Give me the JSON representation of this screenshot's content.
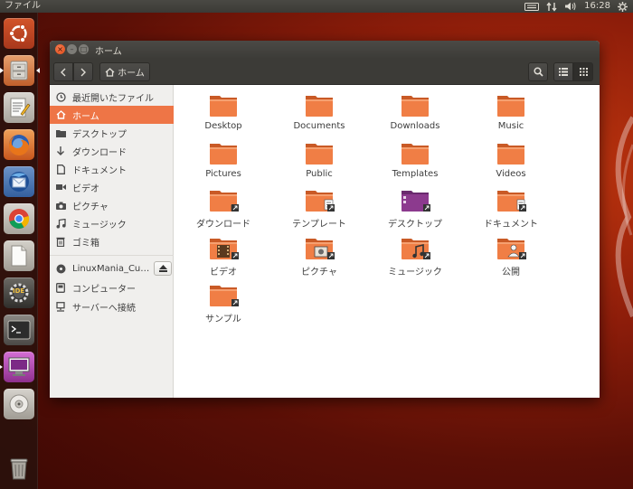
{
  "top_panel": {
    "app_menu": "ファイル",
    "clock": "16:28"
  },
  "launcher": {
    "items": [
      {
        "name": "ubuntu-dash",
        "icon": "ubuntu-logo-icon"
      },
      {
        "name": "files",
        "icon": "file-cabinet-icon",
        "active": true
      },
      {
        "name": "text-editor",
        "icon": "text-editor-icon"
      },
      {
        "name": "firefox",
        "icon": "firefox-icon"
      },
      {
        "name": "thunderbird",
        "icon": "thunderbird-icon"
      },
      {
        "name": "chrome",
        "icon": "chrome-icon"
      },
      {
        "name": "libreoffice",
        "icon": "document-icon"
      },
      {
        "name": "lazarus-ide",
        "icon": "gear-ide-icon"
      },
      {
        "name": "terminal",
        "icon": "terminal-icon"
      },
      {
        "name": "display-settings",
        "icon": "monitor-icon"
      },
      {
        "name": "dvd",
        "icon": "disc-icon"
      },
      {
        "name": "trash",
        "icon": "trash-icon"
      }
    ],
    "ide_label": "IDE"
  },
  "window": {
    "title": "ホーム",
    "path_label": "ホーム"
  },
  "sidebar": {
    "items": [
      {
        "label": "最近開いたファイル",
        "icon": "clock-icon"
      },
      {
        "label": "ホーム",
        "icon": "home-icon",
        "selected": true
      },
      {
        "label": "デスクトップ",
        "icon": "folder-icon"
      },
      {
        "label": "ダウンロード",
        "icon": "download-arrow-icon"
      },
      {
        "label": "ドキュメント",
        "icon": "document-icon"
      },
      {
        "label": "ビデオ",
        "icon": "video-icon"
      },
      {
        "label": "ピクチャ",
        "icon": "camera-icon"
      },
      {
        "label": "ミュージック",
        "icon": "music-note-icon"
      },
      {
        "label": "ゴミ箱",
        "icon": "trash-icon"
      }
    ],
    "devices": [
      {
        "label": "LinuxMania_Cu…",
        "icon": "disc-icon",
        "eject": true
      },
      {
        "label": "コンピューター",
        "icon": "computer-icon"
      },
      {
        "label": "サーバーへ接続",
        "icon": "network-icon"
      }
    ]
  },
  "files": [
    {
      "label": "Desktop",
      "emblem": ""
    },
    {
      "label": "Documents",
      "emblem": ""
    },
    {
      "label": "Downloads",
      "emblem": ""
    },
    {
      "label": "Music",
      "emblem": ""
    },
    {
      "label": "Pictures",
      "emblem": ""
    },
    {
      "label": "Public",
      "emblem": ""
    },
    {
      "label": "Templates",
      "emblem": ""
    },
    {
      "label": "Videos",
      "emblem": ""
    },
    {
      "label": "ダウンロード",
      "emblem": "download"
    },
    {
      "label": "テンプレート",
      "emblem": "template"
    },
    {
      "label": "デスクトップ",
      "emblem": "desktop"
    },
    {
      "label": "ドキュメント",
      "emblem": "document"
    },
    {
      "label": "ビデオ",
      "emblem": "video"
    },
    {
      "label": "ピクチャ",
      "emblem": "picture"
    },
    {
      "label": "ミュージック",
      "emblem": "music"
    },
    {
      "label": "公開",
      "emblem": "public"
    },
    {
      "label": "サンプル",
      "emblem": "link"
    }
  ],
  "colors": {
    "accent": "#ee7546",
    "folder": "#f07e45",
    "panel": "#3c3b37"
  }
}
